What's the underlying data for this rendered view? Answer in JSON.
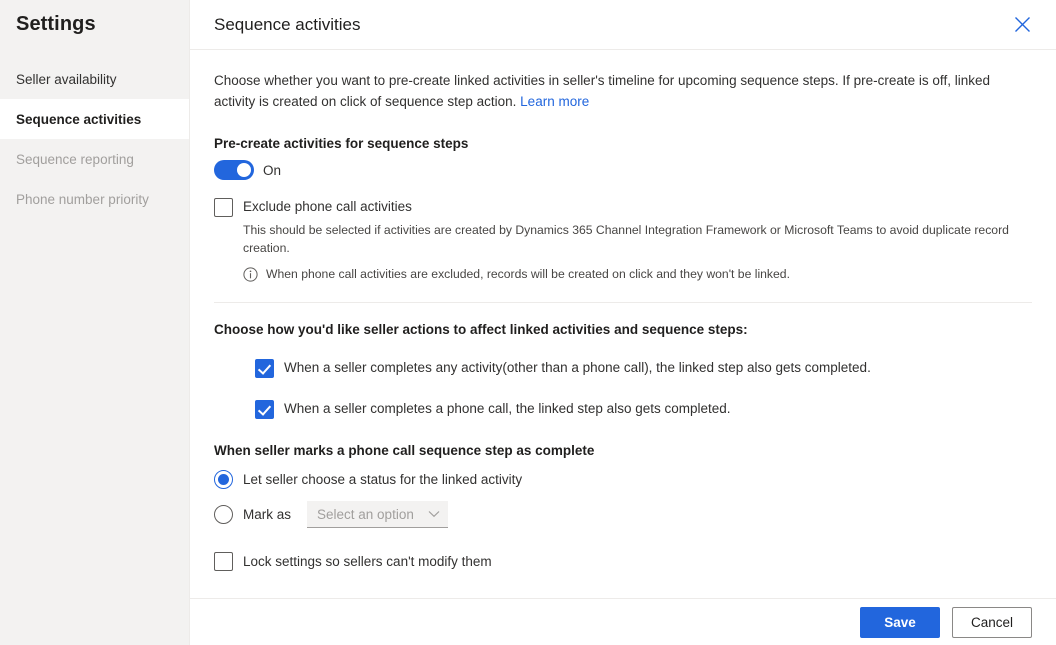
{
  "sidebar": {
    "title": "Settings",
    "items": [
      {
        "label": "Seller availability",
        "state": "normal"
      },
      {
        "label": "Sequence activities",
        "state": "selected"
      },
      {
        "label": "Sequence reporting",
        "state": "disabled"
      },
      {
        "label": "Phone number priority",
        "state": "disabled"
      }
    ]
  },
  "panel": {
    "title": "Sequence activities",
    "close_icon": "close-icon",
    "intro_text": "Choose whether you want to pre-create linked activities in seller's timeline for upcoming sequence steps. If pre-create is off, linked activity is created on click of sequence step action.",
    "learn_more": "Learn more"
  },
  "precreate": {
    "label": "Pre-create activities for sequence steps",
    "toggle_state": "On",
    "toggle_on": true
  },
  "exclude": {
    "label": "Exclude phone call activities",
    "checked": false,
    "description": "This should be selected if activities are created by Dynamics 365 Channel Integration Framework or Microsoft Teams to avoid duplicate record creation.",
    "info_icon": "info-icon",
    "info_text": "When phone call activities are excluded, records will be created on click and they won't be linked."
  },
  "seller_actions": {
    "title": "Choose how you'd like seller actions to affect linked activities and sequence steps:",
    "options": [
      {
        "label": "When a seller completes any activity(other than a phone call), the linked step also gets completed.",
        "checked": true
      },
      {
        "label": "When a seller completes a phone call, the linked step also gets completed.",
        "checked": true
      }
    ]
  },
  "phone_complete": {
    "title": "When seller marks a phone call sequence step as complete",
    "option_let_seller": "Let seller choose a status for the linked activity",
    "option_mark_as": "Mark as",
    "select_placeholder": "Select an option",
    "caret_icon": "chevron-down-icon",
    "selected_option": "let_seller"
  },
  "lock": {
    "label": "Lock settings so sellers can't modify them",
    "checked": false
  },
  "footer": {
    "save_label": "Save",
    "cancel_label": "Cancel"
  },
  "colors": {
    "accent": "#2266dd",
    "sidebar_bg": "#f3f2f1",
    "divider": "#edebe9"
  }
}
